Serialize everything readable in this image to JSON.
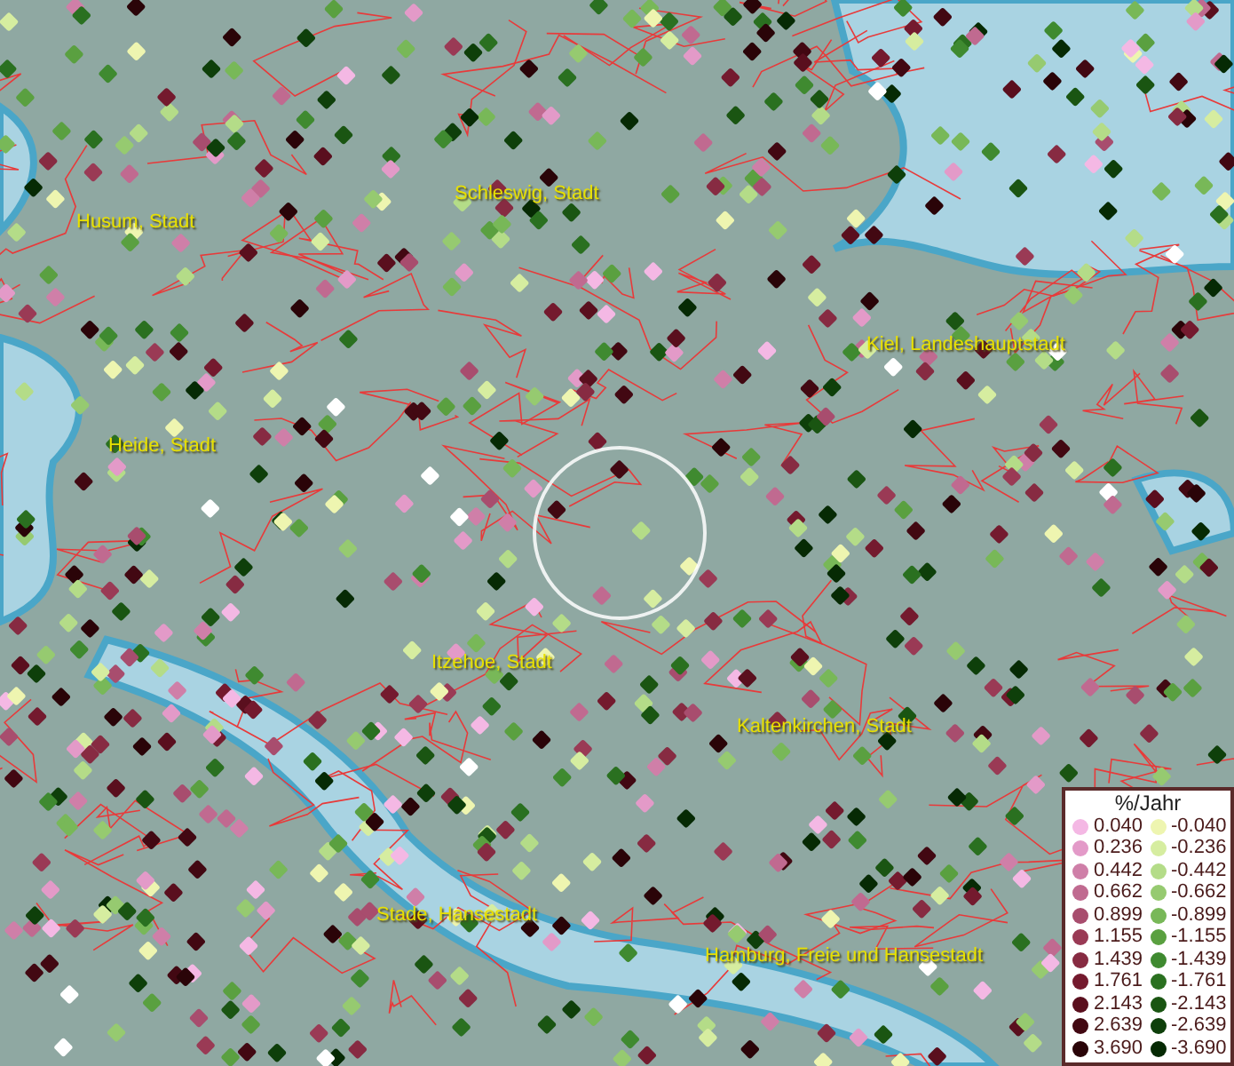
{
  "map": {
    "places": [
      {
        "label": "Husum, Stadt"
      },
      {
        "label": "Schleswig, Stadt"
      },
      {
        "label": "Kiel, Landeshauptstadt"
      },
      {
        "label": "Heide, Stadt"
      },
      {
        "label": "Itzehoe, Stadt"
      },
      {
        "label": "Kaltenkirchen, Stadt"
      },
      {
        "label": "Stade, Hansestadt"
      },
      {
        "label": "Hamburg, Freie und Hansestadt"
      }
    ]
  },
  "legend": {
    "title": "%/Jahr",
    "rows": [
      {
        "positive": {
          "value": "0.040",
          "color": "#f4b8e4"
        },
        "negative": {
          "value": "-0.040",
          "color": "#eef5b0"
        }
      },
      {
        "positive": {
          "value": "0.236",
          "color": "#e39ac8"
        },
        "negative": {
          "value": "-0.236",
          "color": "#d6eda0"
        }
      },
      {
        "positive": {
          "value": "0.442",
          "color": "#cf7fa8"
        },
        "negative": {
          "value": "-0.442",
          "color": "#b4dc88"
        }
      },
      {
        "positive": {
          "value": "0.662",
          "color": "#c06a90"
        },
        "negative": {
          "value": "-0.662",
          "color": "#96ca70"
        }
      },
      {
        "positive": {
          "value": "0.899",
          "color": "#a84d6e"
        },
        "negative": {
          "value": "-0.899",
          "color": "#78b858"
        }
      },
      {
        "positive": {
          "value": "1.155",
          "color": "#9a3a55"
        },
        "negative": {
          "value": "-1.155",
          "color": "#5aa040"
        }
      },
      {
        "positive": {
          "value": "1.439",
          "color": "#872b42"
        },
        "negative": {
          "value": "-1.439",
          "color": "#3f8a30"
        }
      },
      {
        "positive": {
          "value": "1.761",
          "color": "#741a2e"
        },
        "negative": {
          "value": "-1.761",
          "color": "#2a7020"
        }
      },
      {
        "positive": {
          "value": "2.143",
          "color": "#5a0f1e"
        },
        "negative": {
          "value": "-2.143",
          "color": "#1a5512"
        }
      },
      {
        "positive": {
          "value": "2.639",
          "color": "#420812"
        },
        "negative": {
          "value": "-2.639",
          "color": "#0e3f0a"
        }
      },
      {
        "positive": {
          "value": "3.690",
          "color": "#2a0408"
        },
        "negative": {
          "value": "-3.690",
          "color": "#062a04"
        }
      }
    ]
  }
}
